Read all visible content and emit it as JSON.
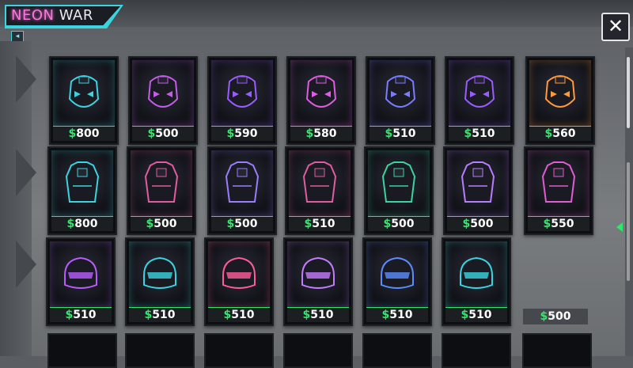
{
  "title": {
    "word1": "NEON",
    "word2": "WAR"
  },
  "buttons": {
    "close_label": "✕",
    "sound_icon": "speaker-icon"
  },
  "currency_symbol": "$",
  "colors": {
    "accent_cyan": "#3ad4e0",
    "accent_pink": "#f27ad8",
    "currency_green": "#2ee86a"
  },
  "rows": [
    {
      "kind": "helmet",
      "items": [
        {
          "price": "800",
          "glow": "#3ad4e0"
        },
        {
          "price": "500",
          "glow": "#c45ce8"
        },
        {
          "price": "590",
          "glow": "#9a5cff"
        },
        {
          "price": "580",
          "glow": "#e05ce0"
        },
        {
          "price": "510",
          "glow": "#7a7cff"
        },
        {
          "price": "510",
          "glow": "#9a5cff"
        },
        {
          "price": "560",
          "glow": "#ff9a3a"
        }
      ]
    },
    {
      "kind": "vest",
      "items": [
        {
          "price": "800",
          "glow": "#3ad4e0"
        },
        {
          "price": "500",
          "glow": "#e05ca0"
        },
        {
          "price": "500",
          "glow": "#9a7cff"
        },
        {
          "price": "510",
          "glow": "#e05ca0"
        },
        {
          "price": "500",
          "glow": "#3ad4a0"
        },
        {
          "price": "500",
          "glow": "#b87cff"
        },
        {
          "price": "550",
          "glow": "#e05cd0"
        }
      ]
    },
    {
      "kind": "visor",
      "items": [
        {
          "price": "510",
          "glow": "#b85cff"
        },
        {
          "price": "510",
          "glow": "#3ad4e0"
        },
        {
          "price": "510",
          "glow": "#ff5c9a"
        },
        {
          "price": "510",
          "glow": "#c47cff"
        },
        {
          "price": "510",
          "glow": "#5c8cff"
        },
        {
          "price": "510",
          "glow": "#3ad4e0"
        }
      ]
    }
  ],
  "empty_slot_price": "500"
}
